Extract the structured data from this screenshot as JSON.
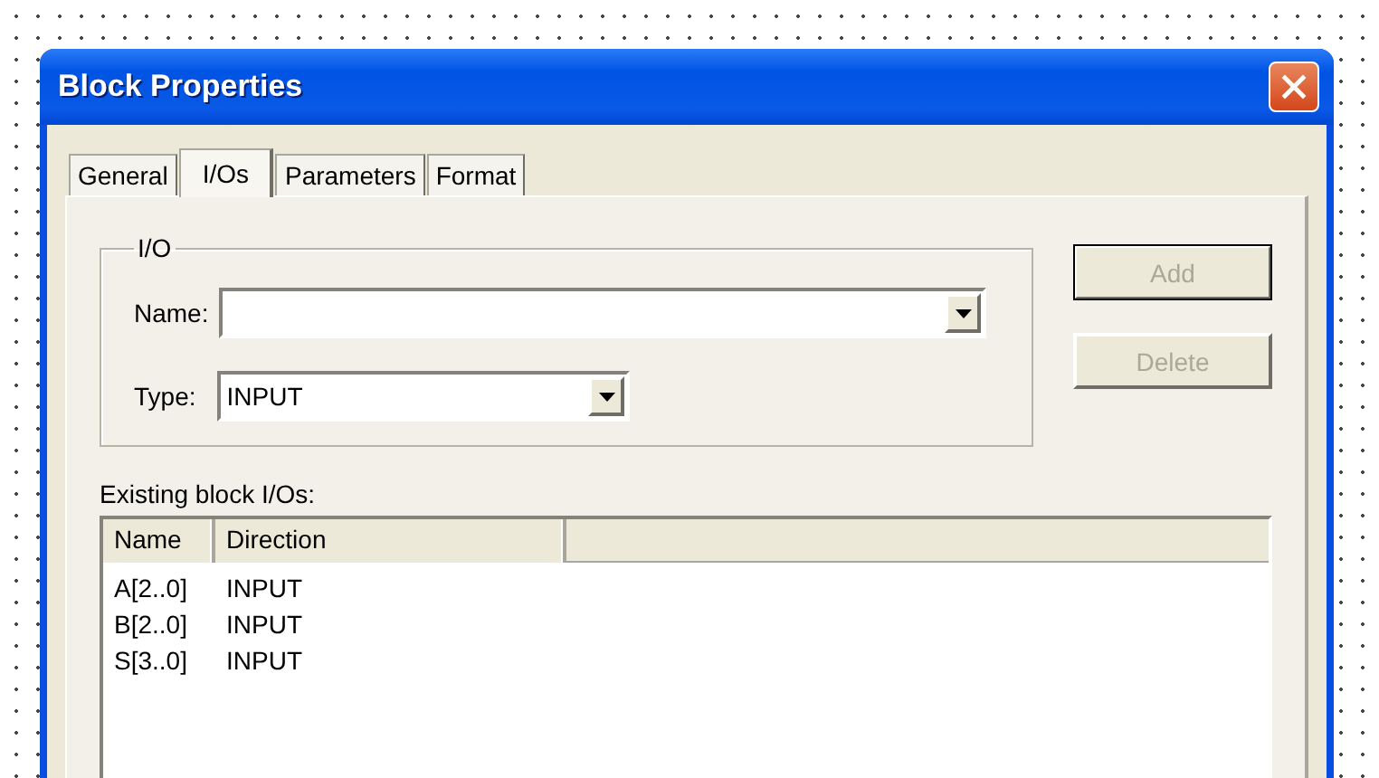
{
  "window": {
    "title": "Block Properties"
  },
  "tabs": [
    {
      "label": "General",
      "selected": false
    },
    {
      "label": "I/Os",
      "selected": true
    },
    {
      "label": "Parameters",
      "selected": false
    },
    {
      "label": "Format",
      "selected": false
    }
  ],
  "io_group": {
    "title": "I/O",
    "name_label": "Name:",
    "type_label": "Type:",
    "type_value": "INPUT"
  },
  "buttons": [
    {
      "label": "Add",
      "disabled": true,
      "default": true
    },
    {
      "label": "Delete",
      "disabled": true,
      "default": false
    }
  ],
  "list": {
    "label": "Existing block I/Os:",
    "columns": [
      "Name",
      "Direction"
    ],
    "rows": [
      [
        "A[2..0]",
        "INPUT"
      ],
      [
        "B[2..0]",
        "INPUT"
      ],
      [
        "S[3..0]",
        "INPUT"
      ]
    ]
  }
}
